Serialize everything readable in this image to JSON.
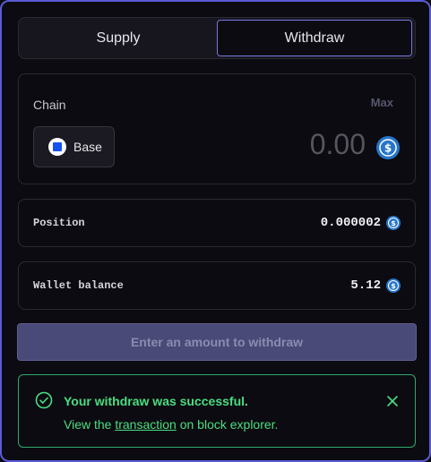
{
  "tabs": {
    "supply_label": "Supply",
    "withdraw_label": "Withdraw",
    "active": "withdraw"
  },
  "chain": {
    "label": "Chain",
    "max_label": "Max",
    "selected": "Base",
    "selected_icon": "base-icon",
    "amount_placeholder": "0.00",
    "amount_value": "",
    "token_icon": "usdc-icon"
  },
  "position": {
    "label": "Position",
    "value": "0.000002",
    "token_icon": "usdc-icon"
  },
  "wallet": {
    "label": "Wallet balance",
    "value": "5.12",
    "token_icon": "usdc-icon"
  },
  "action_button": {
    "label": "Enter an amount to withdraw",
    "disabled": true
  },
  "toast": {
    "title": "Your withdraw was successful.",
    "message_prefix": "View the ",
    "link_text": "transaction",
    "message_suffix": " on block explorer.",
    "status": "success"
  },
  "colors": {
    "accent": "#5b5bd6",
    "success": "#4ade80",
    "usdc": "#2775ca",
    "base": "#1652f0"
  }
}
